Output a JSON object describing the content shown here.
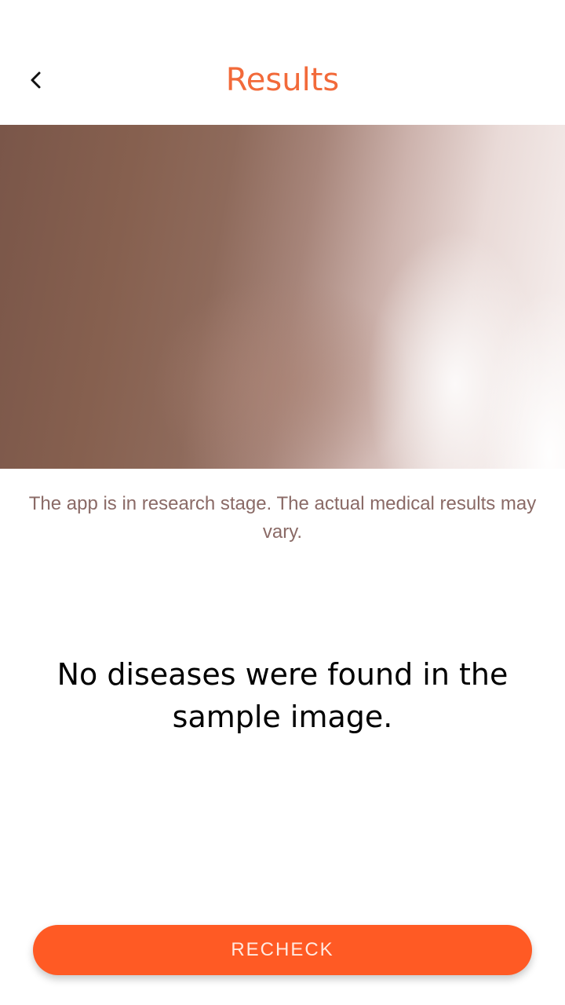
{
  "header": {
    "back_icon": "chevron-left-icon",
    "title": "Results"
  },
  "photo": {
    "description_icon": "sample-image"
  },
  "disclaimer": "The app is in research stage. The actual medical results may vary.",
  "result": "No diseases were found in the sample image.",
  "recheck_button": {
    "label": "RECHECK"
  },
  "colors": {
    "accent": "#f26a3a",
    "button": "#ff5a24",
    "disclaimer_text": "#8a6a66"
  }
}
